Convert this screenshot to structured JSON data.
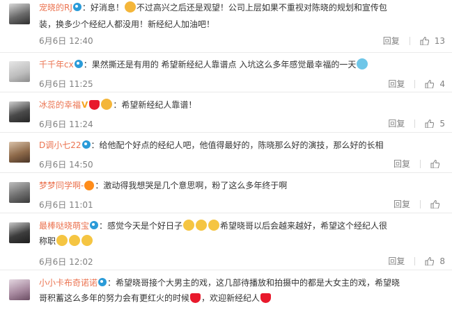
{
  "reply_label": "回复",
  "comments": [
    {
      "user": "宠晓的RJ",
      "line1": "：好消息！",
      "line1b": "不过高兴之后还是观望！公司上层如果不重视对陈晓的规划和宣传包",
      "line2": "装，换多少个经纪人都没用！新经纪人加油吧！",
      "date": "6月6日 12:40",
      "likes": "13"
    },
    {
      "user": "千千年cx",
      "line1": "：果然撕还是有用的 希望新经纪人靠谱点 入坑这么多年感觉最幸福的一天",
      "date": "6月6日 11:25",
      "likes": "4"
    },
    {
      "user": "冰蕊的幸福",
      "line1": "：希望新经纪人靠谱！",
      "date": "6月6日 11:24",
      "likes": "5"
    },
    {
      "user": "D调小七22",
      "line1": "：给他配个好点的经纪人吧，他值得最好的，陈晓那么好的演技，那么好的长相",
      "date": "6月6日 14:50",
      "likes": ""
    },
    {
      "user": "梦梦同学啊-",
      "line1": "：激动得我想哭是几个意思啊，粉了这么多年终于啊",
      "date": "6月6日 11:01",
      "likes": ""
    },
    {
      "user": "最棒哒晓萌宝",
      "line1": "：感觉今天是个好日子",
      "line1b": "希望晓哥以后会越来越好，希望这个经纪人很",
      "line2": "称职",
      "date": "6月6日 12:02",
      "likes": "8"
    },
    {
      "user": "小小卡布奇诺诺",
      "line1": "：希望晓哥接个大男主的戏，这几部待播放和拍摄中的都是大女主的戏，希望晓",
      "line2": "哥积蓄这么多年的努力会有更红火的时候",
      "line2b": "，欢迎新经纪人",
      "date": "",
      "likes": ""
    }
  ],
  "colors": {
    "username": "#eb7350",
    "meta": "#808080",
    "badge": "#2b9bd8"
  }
}
